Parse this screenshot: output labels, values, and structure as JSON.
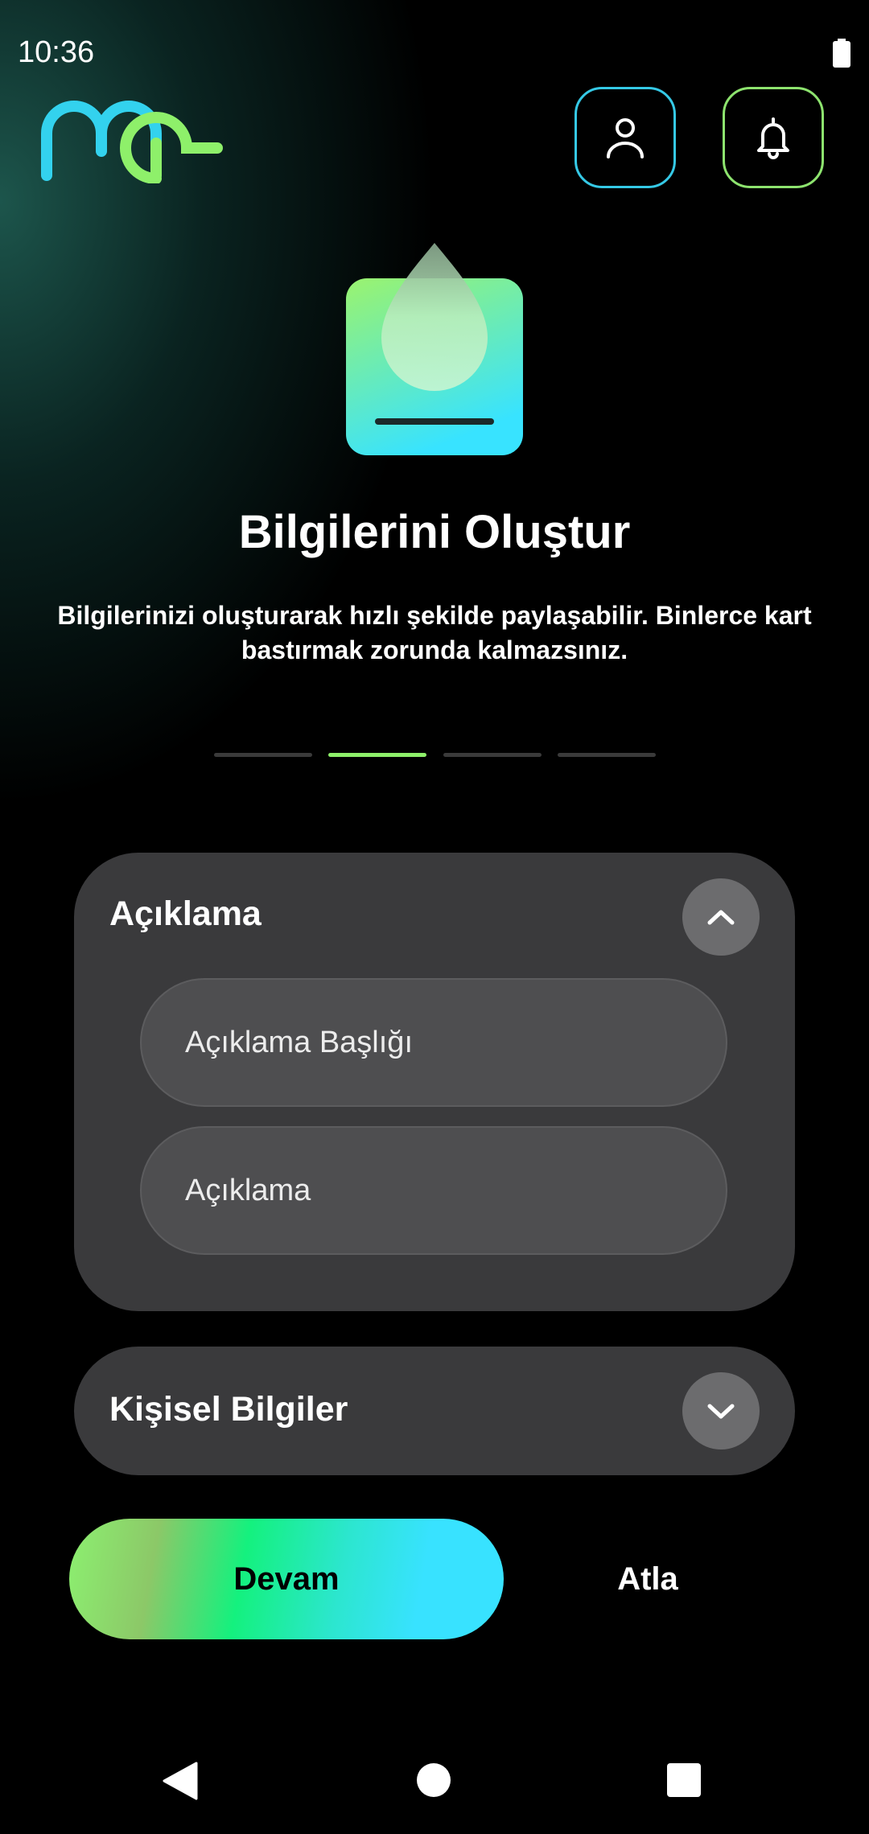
{
  "status_bar": {
    "time": "10:36"
  },
  "header": {
    "logo_icon": "me-logo",
    "profile_icon": "person-icon",
    "notification_icon": "bell-icon"
  },
  "onboarding": {
    "icon": "drop-card-icon",
    "title": "Bilgilerini Oluştur",
    "subtitle_line1": "Bilgilerinizi oluşturarak hızlı şekilde paylaşabilir. Binlerce kart",
    "subtitle_line2": "bastırmak zorunda kalmazsınız.",
    "page_count": 4,
    "active_page": 2
  },
  "sections": {
    "description": {
      "title": "Açıklama",
      "expanded": true,
      "fields": {
        "title_placeholder": "Açıklama Başlığı",
        "description_placeholder": "Açıklama"
      }
    },
    "personal": {
      "title": "Kişisel Bilgiler",
      "expanded": false
    }
  },
  "actions": {
    "continue_label": "Devam",
    "skip_label": "Atla"
  },
  "colors": {
    "accent_green": "#8ef06a",
    "accent_cyan": "#38e2ff",
    "card_bg": "#3a3a3c"
  }
}
